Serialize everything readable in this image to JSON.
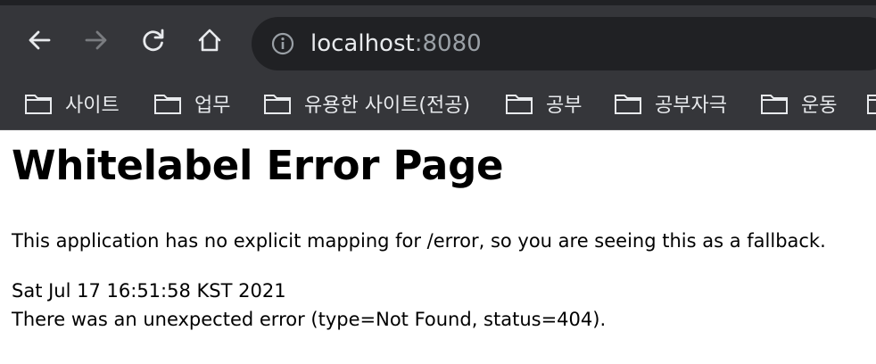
{
  "browser": {
    "url_host": "localhost",
    "url_port": ":8080",
    "nav_icons": [
      "back-icon",
      "forward-icon",
      "reload-icon",
      "home-icon",
      "info-icon"
    ],
    "colors": {
      "toolbar": "#35363a",
      "omnibox": "#202124",
      "text": "#e8eaed",
      "muted": "#9aa0a6"
    }
  },
  "bookmarks": [
    {
      "label": "사이트"
    },
    {
      "label": "업무"
    },
    {
      "label": "유용한 사이트(전공)"
    },
    {
      "label": "공부"
    },
    {
      "label": "공부자극"
    },
    {
      "label": "운동"
    }
  ],
  "page": {
    "title": "Whitelabel Error Page",
    "message": "This application has no explicit mapping for /error, so you are seeing this as a fallback.",
    "timestamp": "Sat Jul 17 16:51:58 KST 2021",
    "error_detail": "There was an unexpected error (type=Not Found, status=404)."
  }
}
